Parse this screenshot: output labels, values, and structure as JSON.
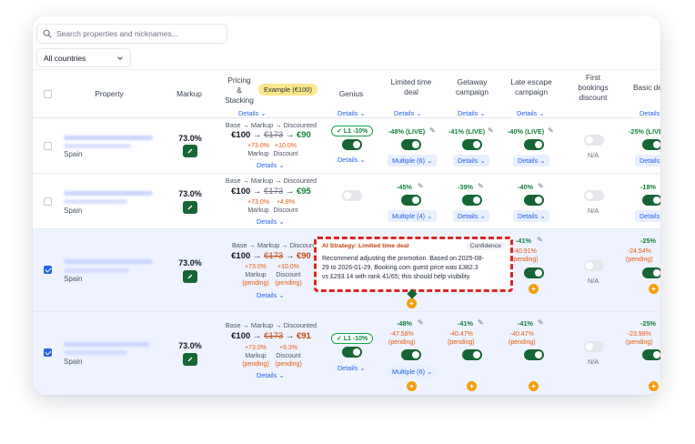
{
  "search": {
    "placeholder": "Search properties and nicknames..."
  },
  "filter": {
    "country_value": "All countries"
  },
  "header": {
    "property": "Property",
    "markup": "Markup",
    "pricing_l1": "Pricing",
    "pricing_l2": "&",
    "pricing_l3": "Stacking",
    "example_badge": "Example (€100)",
    "genius": "Genius",
    "limited_l1": "Limited time",
    "limited_l2": "deal",
    "getaway_l1": "Getaway",
    "getaway_l2": "campaign",
    "late_l1": "Late escape",
    "late_l2": "campaign",
    "first_l1": "First",
    "first_l2": "bookings",
    "first_l3": "discount",
    "basic": "Basic de",
    "details": "Details"
  },
  "labels": {
    "details": "Details",
    "na": "N/A",
    "pending": "(pending)",
    "base_title": "Base → Markup → Discounted",
    "base_title_cut": "Base → Markup → Discounte",
    "markup_word": "Markup",
    "discount_word": "Discount"
  },
  "rows": [
    {
      "country": "Spain",
      "markup": "73.0%",
      "p_base": "€100",
      "p_mid": "€173",
      "p_final": "€90",
      "sub_markup": "+73.0%",
      "sub_discount": "+10.0%",
      "genius": "L1 -10%",
      "limited": "-48% (LIVE)",
      "getaway": "-41% (LIVE)",
      "late": "-40% (LIVE)",
      "basic": "-25% (LIVE",
      "limited_details": "Multiple (6)"
    },
    {
      "country": "Spain",
      "markup": "73.0%",
      "p_base": "€100",
      "p_mid": "€173",
      "p_final": "€95",
      "sub_markup": "+73.0%",
      "sub_discount": "+4.8%",
      "limited": "-45%",
      "getaway": "-39%",
      "late": "-40%",
      "basic": "-18%",
      "limited_details": "Multiple (4)"
    },
    {
      "country": "Spain",
      "markup": "73.0%",
      "p_base": "€100",
      "p_mid": "€173",
      "p_final": "€90",
      "sub_markup": "+73.0%",
      "sub_discount": "+10.0%",
      "late": "-41%",
      "late_pending": "-40.91%",
      "basic": "-25%",
      "basic_pending": "-24.54%"
    },
    {
      "country": "Spain",
      "markup": "73.0%",
      "p_base": "€100",
      "p_mid": "€173",
      "p_final": "€91",
      "sub_markup": "+73.0%",
      "sub_discount": "+9.3%",
      "genius": "L1 -10%",
      "limited": "-48%",
      "limited_pending": "-47.58%",
      "getaway": "-41%",
      "getaway_pending": "-40.47%",
      "late": "-41%",
      "late_pending": "-40.47%",
      "basic": "-25%",
      "basic_pending": "-23.98%",
      "limited_details": "Multiple (6)"
    }
  ],
  "popup": {
    "title": "AI Strategy: Limited time deal",
    "confidence": "Confidence",
    "line1": "Recommend adjusting the promotion. Based on 2025-08-",
    "line2": "29 to 2026-01-29, Booking.com guest price was £382.3",
    "line3": "vs £293.14 with rank 41/65; this should help visibility."
  },
  "colors": {
    "accent": "#2563eb",
    "toggle_on": "#166534",
    "live_green": "#15803d",
    "pending_orange": "#ea580c",
    "popup_border": "#dc2626",
    "ai_badge": "#f59e0b"
  }
}
